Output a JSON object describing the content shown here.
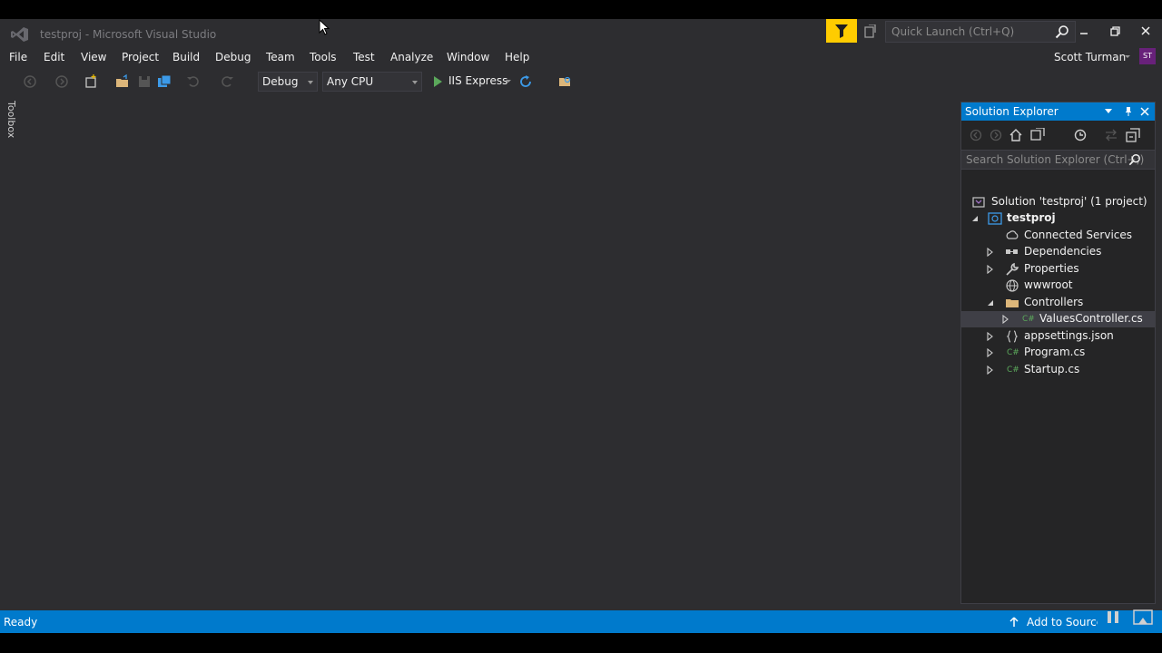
{
  "window": {
    "title": "testproj - Microsoft Visual Studio",
    "quick_launch_placeholder": "Quick Launch (Ctrl+Q)",
    "user_name": "Scott Turman",
    "avatar_initials": "ST"
  },
  "menu": [
    "File",
    "Edit",
    "View",
    "Project",
    "Build",
    "Debug",
    "Team",
    "Tools",
    "Test",
    "Analyze",
    "Window",
    "Help"
  ],
  "toolbar": {
    "config": "Debug",
    "platform": "Any CPU",
    "run_target": "IIS Express"
  },
  "toolbox_tab": "Toolbox",
  "solution_explorer": {
    "title": "Solution Explorer",
    "search_placeholder": "Search Solution Explorer (Ctrl+;)",
    "tree": [
      {
        "label": "Solution 'testproj' (1 project)",
        "icon": "solution-icon"
      },
      {
        "label": "testproj",
        "icon": "web-project-icon"
      },
      {
        "label": "Connected Services",
        "icon": "connected-services-icon"
      },
      {
        "label": "Dependencies",
        "icon": "dependencies-icon"
      },
      {
        "label": "Properties",
        "icon": "wrench-icon"
      },
      {
        "label": "wwwroot",
        "icon": "globe-icon"
      },
      {
        "label": "Controllers",
        "icon": "folder-icon"
      },
      {
        "label": "ValuesController.cs",
        "icon": "csharp-file-icon"
      },
      {
        "label": "appsettings.json",
        "icon": "json-file-icon"
      },
      {
        "label": "Program.cs",
        "icon": "csharp-file-icon"
      },
      {
        "label": "Startup.cs",
        "icon": "csharp-file-icon"
      }
    ]
  },
  "status": {
    "text": "Ready",
    "source_control": "Add to Source Control"
  },
  "colors": {
    "accent": "#007acc",
    "background": "#2d2d30",
    "filter_button": "#ffcc00",
    "avatar": "#68217a"
  }
}
